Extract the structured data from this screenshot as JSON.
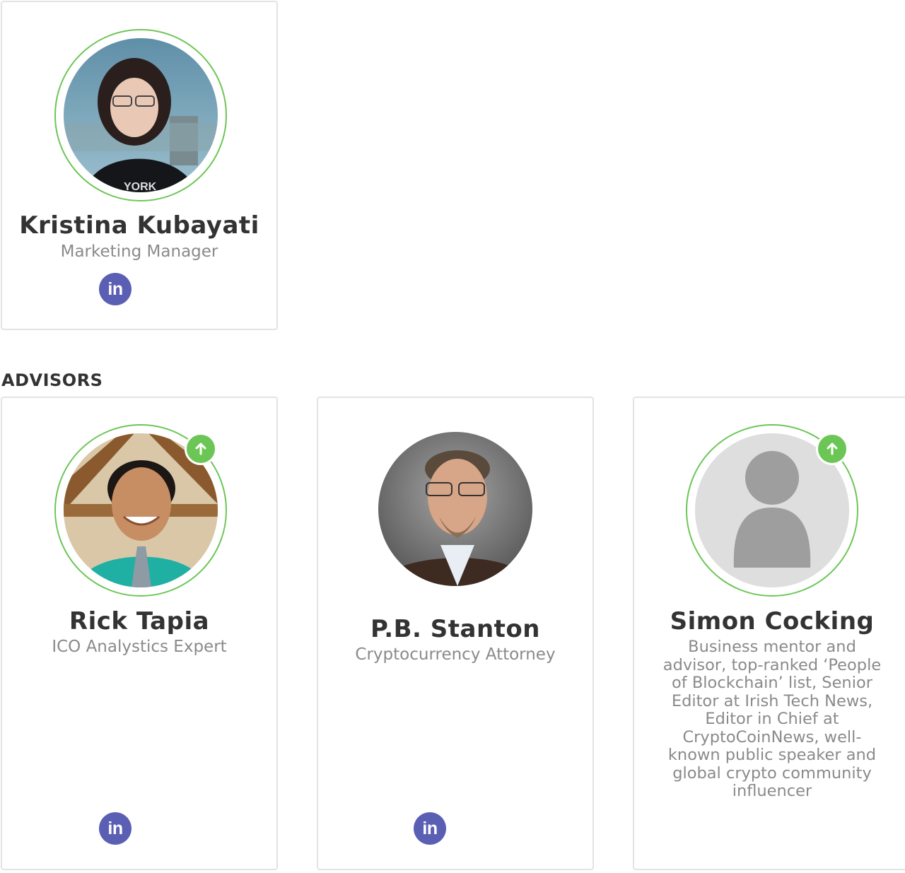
{
  "team": {
    "member": {
      "name": "Kristina Kubayati",
      "role": "Marketing Manager",
      "social_icon": "linkedin-icon",
      "social_label": "in"
    }
  },
  "advisors": {
    "title": "ADVISORS",
    "items": [
      {
        "name": "Rick Tapia",
        "role": "ICO Analystics Expert",
        "social_label": "in",
        "badge_icon": "arrow-up-icon"
      },
      {
        "name": "P.B. Stanton",
        "role": "Cryptocurrency Attorney",
        "social_label": "in"
      },
      {
        "name": "Simon Cocking",
        "role": "Business mentor and advisor, top-ranked ‘People of Blockchain’ list, Senior Editor at Irish Tech News, Editor in Chief at CryptoCoinNews, well-known public speaker and global crypto community influencer",
        "badge_icon": "arrow-up-icon"
      }
    ]
  },
  "colors": {
    "ring": "#6cc656",
    "linkedin": "#5b5fb4",
    "name_text": "#333333",
    "role_text": "#8a8a8a"
  }
}
